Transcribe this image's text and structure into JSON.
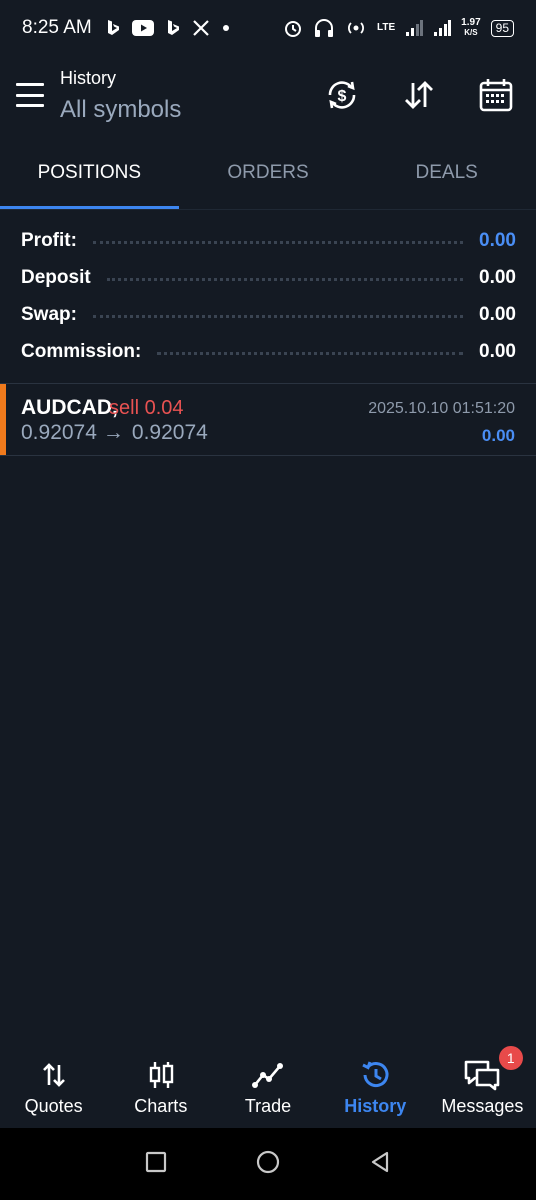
{
  "status_bar": {
    "time": "8:25 AM",
    "network": "LTE",
    "speed_value": "1.97",
    "speed_unit": "K/S",
    "battery": "95"
  },
  "header": {
    "title": "History",
    "subtitle": "All symbols",
    "icons": [
      "currency-refresh-icon",
      "sort-arrows-icon",
      "calendar-icon"
    ]
  },
  "tabs": [
    {
      "label": "POSITIONS",
      "active": true
    },
    {
      "label": "ORDERS",
      "active": false
    },
    {
      "label": "DEALS",
      "active": false
    }
  ],
  "summary": [
    {
      "label": "Profit:",
      "value": "0.00"
    },
    {
      "label": "Deposit",
      "value": "0.00"
    },
    {
      "label": "Swap:",
      "value": "0.00"
    },
    {
      "label": "Commission:",
      "value": "0.00"
    }
  ],
  "position": {
    "symbol": "AUDCAD,",
    "side": "sell 0.04",
    "open_price": "0.92074",
    "arrow": "→",
    "close_price": "0.92074",
    "datetime": "2025.10.10 01:51:20",
    "profit": "0.00"
  },
  "bottom_nav": [
    {
      "label": "Quotes",
      "icon": "quotes-arrows-icon"
    },
    {
      "label": "Charts",
      "icon": "candlestick-icon"
    },
    {
      "label": "Trade",
      "icon": "trade-line-icon"
    },
    {
      "label": "History",
      "icon": "history-clock-icon",
      "active": true
    },
    {
      "label": "Messages",
      "icon": "chat-bubbles-icon",
      "badge": "1"
    }
  ],
  "colors": {
    "background": "#141a23",
    "accent_blue": "#3d86f0",
    "sell_red": "#e85252",
    "position_marker": "#f07a1c"
  }
}
